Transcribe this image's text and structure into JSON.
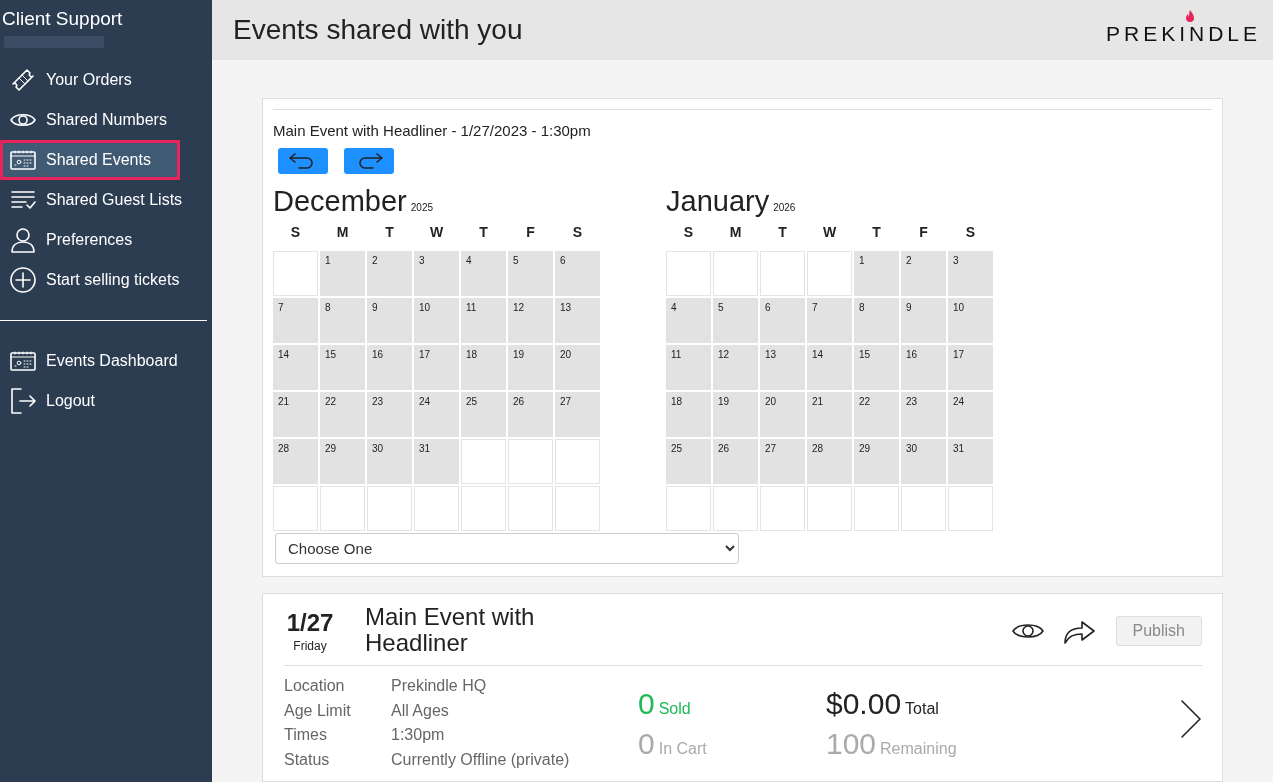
{
  "sidebar": {
    "title": "Client Support",
    "items": [
      {
        "label": "Your Orders",
        "selected": false
      },
      {
        "label": "Shared Numbers",
        "selected": false
      },
      {
        "label": "Shared Events",
        "selected": true
      },
      {
        "label": "Shared Guest Lists",
        "selected": false
      },
      {
        "label": "Preferences",
        "selected": false
      },
      {
        "label": "Start selling tickets",
        "selected": false
      }
    ],
    "bottom_items": [
      {
        "label": "Events Dashboard",
        "selected": false
      },
      {
        "label": "Logout",
        "selected": false
      }
    ]
  },
  "header": {
    "title": "Events shared with you",
    "logo": "PREKINDLE"
  },
  "calendar_card": {
    "event_title": "Main Event with Headliner - 1/27/2023 - 1:30pm",
    "months": [
      {
        "name": "December",
        "year": "2025",
        "weekdays": [
          "S",
          "M",
          "T",
          "W",
          "T",
          "F",
          "S"
        ],
        "weeks": [
          [
            {
              "kind": "blank"
            },
            {
              "kind": "day",
              "day": "1"
            },
            {
              "kind": "day",
              "day": "2"
            },
            {
              "kind": "day",
              "day": "3"
            },
            {
              "kind": "day",
              "day": "4"
            },
            {
              "kind": "day",
              "day": "5"
            },
            {
              "kind": "day",
              "day": "6"
            }
          ],
          [
            {
              "kind": "day",
              "day": "7"
            },
            {
              "kind": "day",
              "day": "8"
            },
            {
              "kind": "day",
              "day": "9"
            },
            {
              "kind": "day",
              "day": "10"
            },
            {
              "kind": "day",
              "day": "11"
            },
            {
              "kind": "day",
              "day": "12"
            },
            {
              "kind": "day",
              "day": "13"
            }
          ],
          [
            {
              "kind": "day",
              "day": "14"
            },
            {
              "kind": "day",
              "day": "15"
            },
            {
              "kind": "day",
              "day": "16"
            },
            {
              "kind": "day",
              "day": "17"
            },
            {
              "kind": "day",
              "day": "18"
            },
            {
              "kind": "day",
              "day": "19"
            },
            {
              "kind": "day",
              "day": "20"
            }
          ],
          [
            {
              "kind": "day",
              "day": "21"
            },
            {
              "kind": "day",
              "day": "22"
            },
            {
              "kind": "day",
              "day": "23"
            },
            {
              "kind": "day",
              "day": "24"
            },
            {
              "kind": "day",
              "day": "25"
            },
            {
              "kind": "day",
              "day": "26"
            },
            {
              "kind": "day",
              "day": "27"
            }
          ],
          [
            {
              "kind": "day",
              "day": "28"
            },
            {
              "kind": "day",
              "day": "29"
            },
            {
              "kind": "day",
              "day": "30"
            },
            {
              "kind": "day",
              "day": "31"
            },
            {
              "kind": "blank"
            },
            {
              "kind": "blank"
            },
            {
              "kind": "blank"
            }
          ],
          [
            {
              "kind": "blank"
            },
            {
              "kind": "blank"
            },
            {
              "kind": "blank"
            },
            {
              "kind": "blank"
            },
            {
              "kind": "blank"
            },
            {
              "kind": "blank"
            },
            {
              "kind": "blank"
            }
          ]
        ]
      },
      {
        "name": "January",
        "year": "2026",
        "weekdays": [
          "S",
          "M",
          "T",
          "W",
          "T",
          "F",
          "S"
        ],
        "weeks": [
          [
            {
              "kind": "blank"
            },
            {
              "kind": "blank"
            },
            {
              "kind": "blank"
            },
            {
              "kind": "blank"
            },
            {
              "kind": "day",
              "day": "1"
            },
            {
              "kind": "day",
              "day": "2"
            },
            {
              "kind": "day",
              "day": "3"
            }
          ],
          [
            {
              "kind": "day",
              "day": "4"
            },
            {
              "kind": "day",
              "day": "5"
            },
            {
              "kind": "day",
              "day": "6"
            },
            {
              "kind": "day",
              "day": "7"
            },
            {
              "kind": "day",
              "day": "8"
            },
            {
              "kind": "day",
              "day": "9"
            },
            {
              "kind": "day",
              "day": "10"
            }
          ],
          [
            {
              "kind": "day",
              "day": "11"
            },
            {
              "kind": "day",
              "day": "12"
            },
            {
              "kind": "day",
              "day": "13"
            },
            {
              "kind": "day",
              "day": "14"
            },
            {
              "kind": "day",
              "day": "15"
            },
            {
              "kind": "day",
              "day": "16"
            },
            {
              "kind": "day",
              "day": "17"
            }
          ],
          [
            {
              "kind": "day",
              "day": "18"
            },
            {
              "kind": "day",
              "day": "19"
            },
            {
              "kind": "day",
              "day": "20"
            },
            {
              "kind": "day",
              "day": "21"
            },
            {
              "kind": "day",
              "day": "22"
            },
            {
              "kind": "day",
              "day": "23"
            },
            {
              "kind": "day",
              "day": "24"
            }
          ],
          [
            {
              "kind": "day",
              "day": "25"
            },
            {
              "kind": "day",
              "day": "26"
            },
            {
              "kind": "day",
              "day": "27"
            },
            {
              "kind": "day",
              "day": "28"
            },
            {
              "kind": "day",
              "day": "29"
            },
            {
              "kind": "day",
              "day": "30"
            },
            {
              "kind": "day",
              "day": "31"
            }
          ],
          [
            {
              "kind": "blank"
            },
            {
              "kind": "blank"
            },
            {
              "kind": "blank"
            },
            {
              "kind": "blank"
            },
            {
              "kind": "blank"
            },
            {
              "kind": "blank"
            },
            {
              "kind": "blank"
            }
          ]
        ]
      }
    ],
    "select": {
      "value": "Choose One"
    }
  },
  "event_card": {
    "date": "1/27",
    "weekday": "Friday",
    "title": "Main Event with Headliner",
    "publish": {
      "label": "Publish",
      "disabled": true
    },
    "details": [
      {
        "label": "Location",
        "value": "Prekindle HQ"
      },
      {
        "label": "Age Limit",
        "value": "All Ages"
      },
      {
        "label": "Times",
        "value": "1:30pm"
      },
      {
        "label": "Status",
        "value": "Currently Offline (private)"
      }
    ],
    "stats": [
      {
        "value": "0",
        "label": "Sold",
        "color": "#1db954"
      },
      {
        "value": "$0.00",
        "label": "Total",
        "color": "#222222"
      },
      {
        "value": "0",
        "label": "In Cart",
        "color": "#aaaaaa"
      },
      {
        "value": "100",
        "label": "Remaining",
        "color": "#aaaaaa"
      }
    ]
  }
}
